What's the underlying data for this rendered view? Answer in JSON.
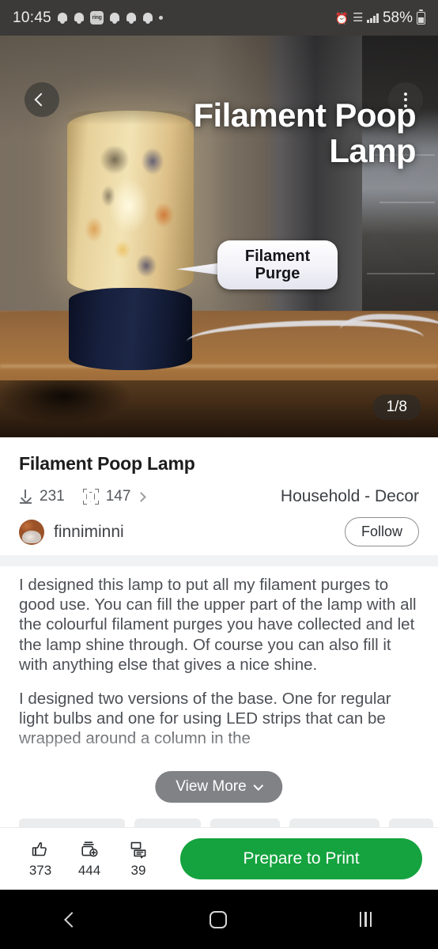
{
  "status_bar": {
    "time": "10:45",
    "icons": [
      "bell-icon",
      "bell-icon",
      "ring-app-icon",
      "bell-icon",
      "bell-icon",
      "bell-icon",
      "dot-icon"
    ],
    "ring_label": "ring",
    "alarm_icon": "alarm-icon",
    "wifi_icon": "wifi-icon",
    "signal_icon": "signal-bars-icon",
    "battery_percent": "58%"
  },
  "hero": {
    "back_icon": "chevron-left-icon",
    "menu_icon": "kebab-menu-icon",
    "overlay_title": "Filament Poop Lamp",
    "annotation_bubble": "Filament\nPurge",
    "annotation_line1": "Filament",
    "annotation_line2": "Purge",
    "pager": "1/8"
  },
  "info": {
    "title": "Filament Poop Lamp",
    "downloads": {
      "icon": "download-icon",
      "count": "231"
    },
    "makes": {
      "icon": "3d-cube-scan-icon",
      "count": "147",
      "chevron": "chevron-right-icon"
    },
    "category": "Household - Decor",
    "author": {
      "avatar": "user-avatar",
      "name": "finniminni"
    },
    "follow_label": "Follow"
  },
  "description": {
    "paragraphs": [
      "I designed this lamp to put all my filament purges to good use. You can fill the upper part of the lamp with all the colourful filament purges you have collected and let the lamp shine through. Of course you can also fill it with anything else that gives a nice shine.",
      "I designed two versions of the base. One for regular light bulbs and one for using LED strips that can be wrapped around a column in the"
    ],
    "view_more_label": "View More",
    "view_more_chevron": "chevron-down-icon"
  },
  "action_bar": {
    "like": {
      "icon": "thumbs-up-icon",
      "count": "373"
    },
    "collect": {
      "icon": "add-to-collection-icon",
      "count": "444"
    },
    "comment": {
      "icon": "comment-icon",
      "count": "39"
    },
    "primary_label": "Prepare to Print",
    "primary_color": "#14a33e"
  },
  "nav_bar": {
    "back_icon": "android-back-icon",
    "home_icon": "android-home-icon",
    "recents_icon": "android-recents-icon"
  }
}
